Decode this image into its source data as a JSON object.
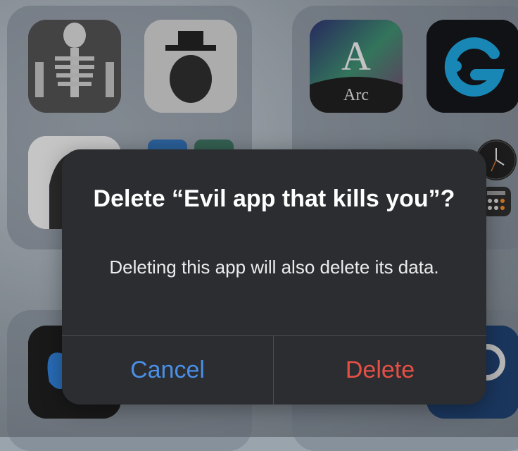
{
  "alert": {
    "title": "Delete “Evil app that kills you”?",
    "message": "Deleting this app will also delete its data.",
    "cancel_label": "Cancel",
    "delete_label": "Delete"
  },
  "home_screen": {
    "arc_app_label": "Arc"
  },
  "colors": {
    "cancel": "#4a8fe8",
    "delete": "#e55046",
    "dialog_bg": "#2b2d30"
  }
}
